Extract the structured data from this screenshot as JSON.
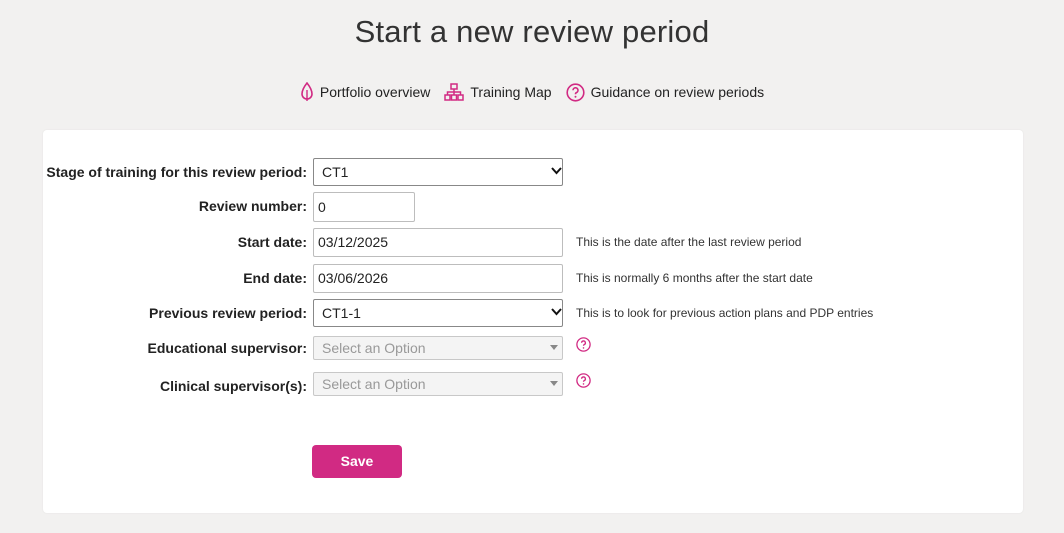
{
  "page": {
    "title": "Start a new review period"
  },
  "nav": {
    "portfolio": "Portfolio overview",
    "training_map": "Training Map",
    "guidance": "Guidance on review periods"
  },
  "form": {
    "stage": {
      "label": "Stage of training for this review period:",
      "value": "CT1"
    },
    "review_number": {
      "label": "Review number:",
      "value": "0"
    },
    "start_date": {
      "label": "Start date:",
      "value": "03/12/2025",
      "help": "This is the date after the last review period"
    },
    "end_date": {
      "label": "End date:",
      "value": "03/06/2026",
      "help": "This is normally 6 months after the start date"
    },
    "previous": {
      "label": "Previous review period:",
      "value": "CT1-1",
      "help": "This is to look for previous action plans and PDP entries"
    },
    "educational_supervisor": {
      "label": "Educational supervisor:",
      "placeholder": "Select an Option"
    },
    "clinical_supervisor": {
      "label": "Clinical supervisor(s):",
      "placeholder": "Select an Option"
    },
    "save_label": "Save"
  },
  "colors": {
    "accent": "#d12a83",
    "background": "#f2f1f0"
  },
  "icons": {
    "portfolio": "leaf-icon",
    "training_map": "sitemap-icon",
    "guidance": "question-circle-icon"
  }
}
